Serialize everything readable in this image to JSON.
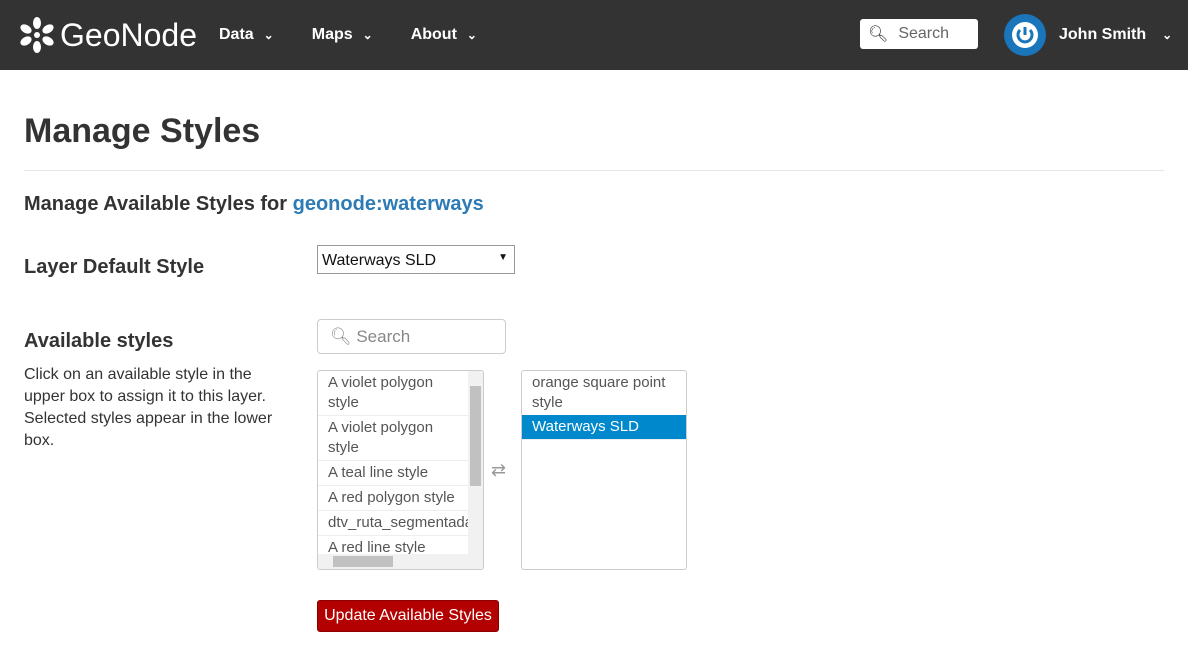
{
  "nav": {
    "brand": "GeoNode",
    "menu": [
      "Data",
      "Maps",
      "About"
    ],
    "search_placeholder": "Search",
    "user": "John Smith"
  },
  "page": {
    "title": "Manage Styles",
    "subtitle": "Manage Available Styles for ",
    "layer": "geonode:waterways",
    "default_label": "Layer Default Style",
    "default_value": "Waterways SLD",
    "available_label": "Available styles",
    "help": "Click on an available style in the upper box to assign it to this layer. Selected styles appear in the lower box.",
    "search_placeholder": "Search",
    "available": [
      "A violet polygon style",
      "A violet polygon style",
      "A teal line style",
      "A red polygon style",
      "dtv_ruta_segmentada_p",
      "A red line style"
    ],
    "selected": [
      "orange square point style",
      "Waterways SLD"
    ],
    "update_button": "Update Available Styles"
  }
}
